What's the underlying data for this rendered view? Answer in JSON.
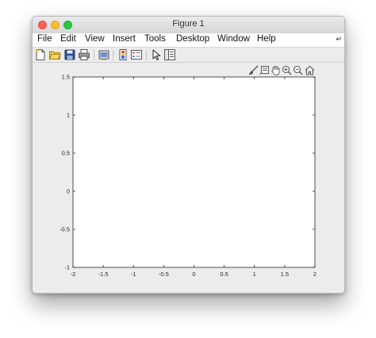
{
  "window": {
    "title": "Figure 1"
  },
  "menubar": {
    "items": [
      "File",
      "Edit",
      "View",
      "Insert",
      "Tools",
      "Desktop",
      "Window",
      "Help"
    ],
    "overflow_icon": "menu-overflow-arrow"
  },
  "toolbar": {
    "buttons": [
      "new-figure-icon",
      "open-file-icon",
      "save-icon",
      "print-icon",
      "link-plot-icon",
      "insert-colorbar-icon",
      "insert-legend-icon",
      "edit-plot-pointer-icon",
      "property-inspector-icon"
    ]
  },
  "axes_toolbar": {
    "buttons": [
      "brush-icon",
      "data-tips-icon",
      "pan-hand-icon",
      "zoom-in-icon",
      "zoom-out-icon",
      "home-restore-view-icon"
    ]
  },
  "colors": {
    "window_bg": "#ececec",
    "axes_bg": "#ffffff",
    "axes_line": "#262626"
  },
  "chart_data": {
    "type": "line",
    "title": "",
    "xlabel": "",
    "ylabel": "",
    "xlim": [
      -2,
      2
    ],
    "ylim": [
      -1,
      1.5
    ],
    "xticks": [
      "-2",
      "-1.5",
      "-1",
      "-0.5",
      "0",
      "0.5",
      "1",
      "1.5",
      "2"
    ],
    "yticks": [
      "-1",
      "-0.5",
      "0",
      "0.5",
      "1",
      "1.5"
    ],
    "series": [],
    "grid": false
  }
}
